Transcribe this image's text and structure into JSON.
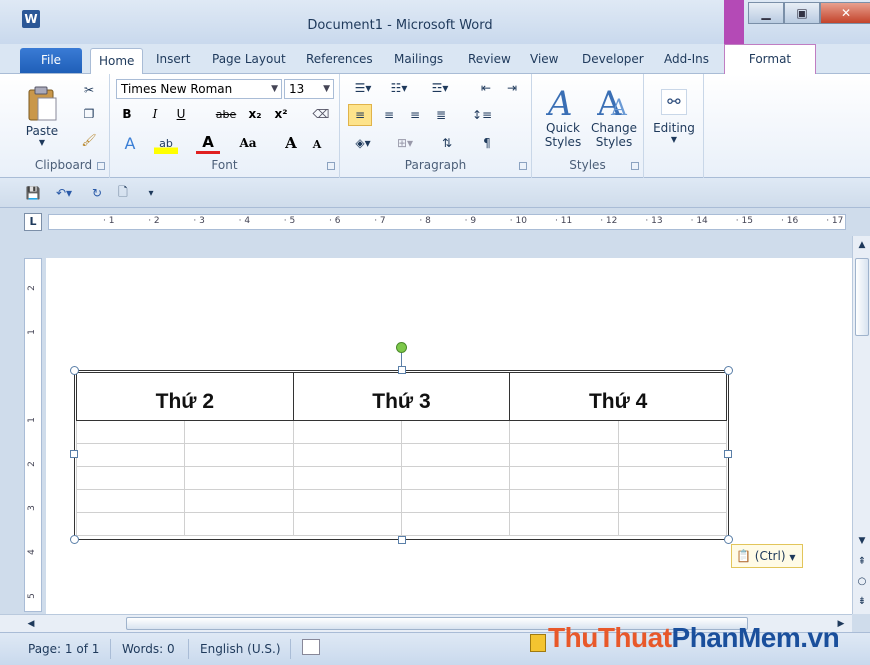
{
  "window": {
    "title": "Document1  -  Microsoft Word",
    "app_icon_letter": "W"
  },
  "tabs": {
    "file": "File",
    "home": "Home",
    "insert": "Insert",
    "page_layout": "Page Layout",
    "references": "References",
    "mailings": "Mailings",
    "review": "Review",
    "view": "View",
    "developer": "Developer",
    "add_ins": "Add-Ins",
    "format": "Format"
  },
  "ribbon": {
    "clipboard": {
      "paste_label": "Paste",
      "group_label": "Clipboard"
    },
    "font": {
      "font_name": "Times New Roman",
      "font_size": "13",
      "bold": "B",
      "italic": "I",
      "underline": "U",
      "strike": "abe",
      "subscript": "x₂",
      "superscript": "x²",
      "grow": "A",
      "shrink": "A",
      "change_case": "Aa",
      "group_label": "Font"
    },
    "paragraph": {
      "group_label": "Paragraph",
      "pilcrow": "¶"
    },
    "styles": {
      "quick_styles": "Quick Styles",
      "change_styles": "Change Styles",
      "group_label": "Styles"
    },
    "editing": {
      "label": "Editing"
    }
  },
  "document": {
    "table_headers": [
      "Thứ 2",
      "Thứ 3",
      "Thứ 4"
    ],
    "empty_rows": 5,
    "columns": 6
  },
  "ruler": {
    "h_numbers": [
      "1",
      "2",
      "3",
      "4",
      "5",
      "6",
      "7",
      "8",
      "9",
      "10",
      "11",
      "12",
      "13",
      "14",
      "15",
      "16",
      "17"
    ],
    "v_numbers": [
      "2",
      "1",
      "1",
      "2",
      "3",
      "4",
      "5"
    ]
  },
  "paste_options": {
    "label": "(Ctrl)"
  },
  "status": {
    "page": "Page: 1 of 1",
    "words": "Words: 0",
    "language": "English (U.S.)"
  },
  "watermark": {
    "part1": "Thu",
    "part2": "Thuat",
    "part3": "PhanMem",
    "part4": ".vn"
  },
  "colors": {
    "accent": "#2b5797",
    "format_tab": "#b44ab6",
    "watermark_orange": "#e8582a",
    "watermark_blue": "#1a4f9c"
  }
}
